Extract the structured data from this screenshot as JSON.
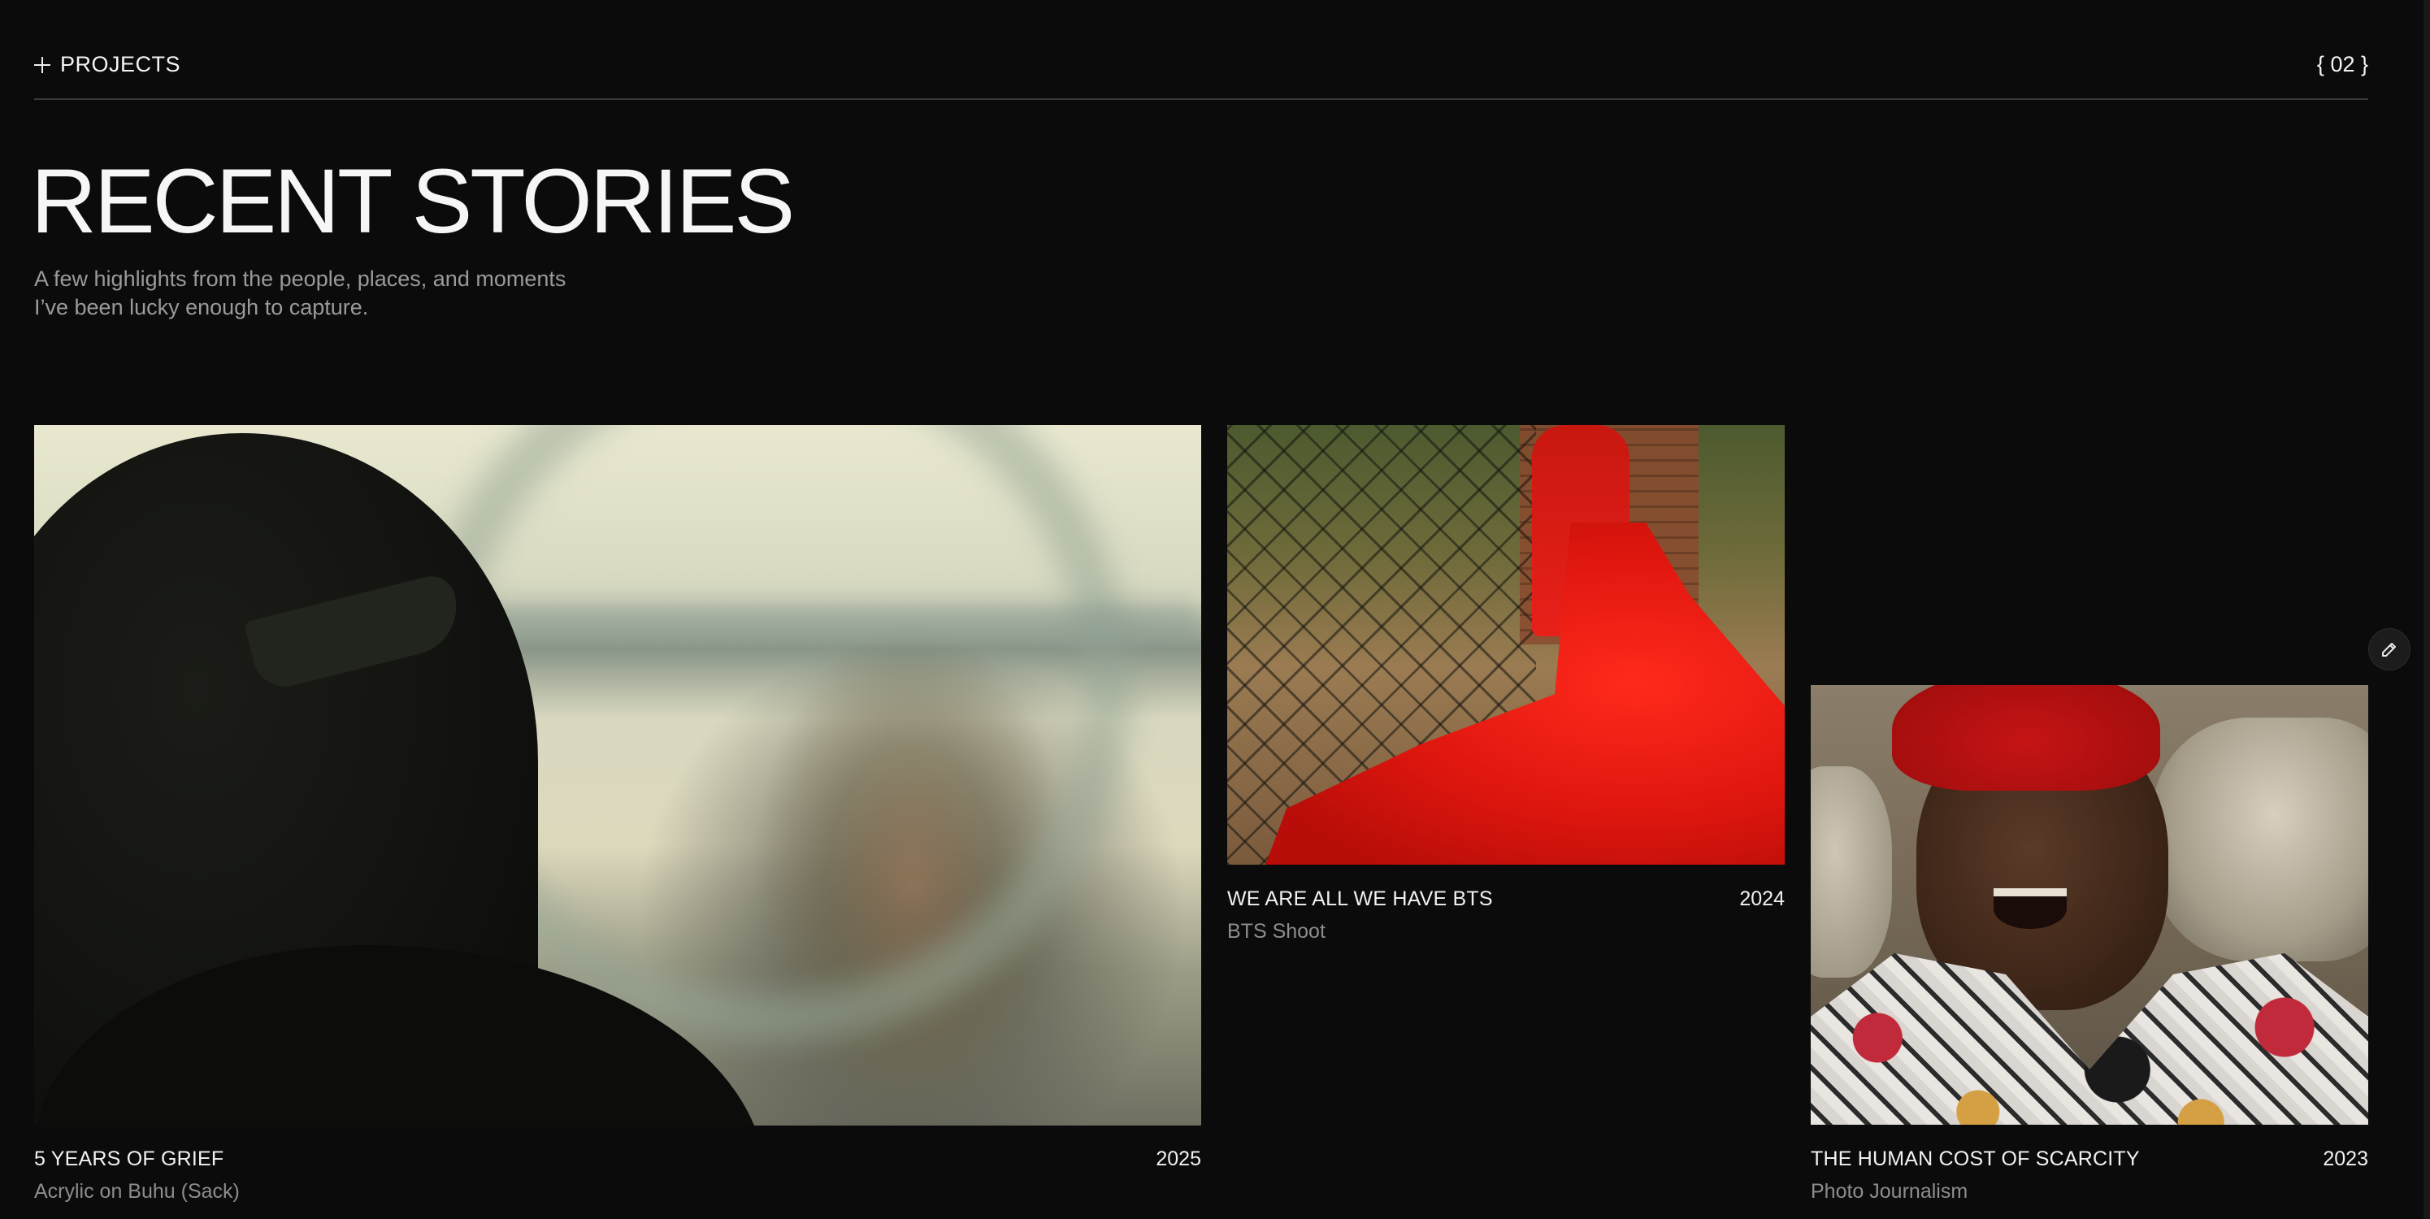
{
  "header": {
    "section_label": "PROJECTS",
    "section_index": "{ 02 }"
  },
  "hero": {
    "title": "RECENT STORIES",
    "subtitle_line1": "A few highlights from the people, places, and moments",
    "subtitle_line2": "I’ve been lucky enough to capture."
  },
  "projects": [
    {
      "title": "5 YEARS OF GRIEF",
      "year": "2025",
      "subtitle": "Acrylic on Buhu (Sack)"
    },
    {
      "title": "WE ARE ALL WE HAVE BTS",
      "year": "2024",
      "subtitle": "BTS Shoot"
    },
    {
      "title": "THE HUMAN COST OF SCARCITY",
      "year": "2023",
      "subtitle": "Photo Journalism"
    }
  ],
  "icons": {
    "section": "plus-icon",
    "edit": "pencil-icon"
  },
  "colors": {
    "background": "#0b0b0b",
    "text": "#f2f2f2",
    "muted": "#9a9a9a"
  }
}
